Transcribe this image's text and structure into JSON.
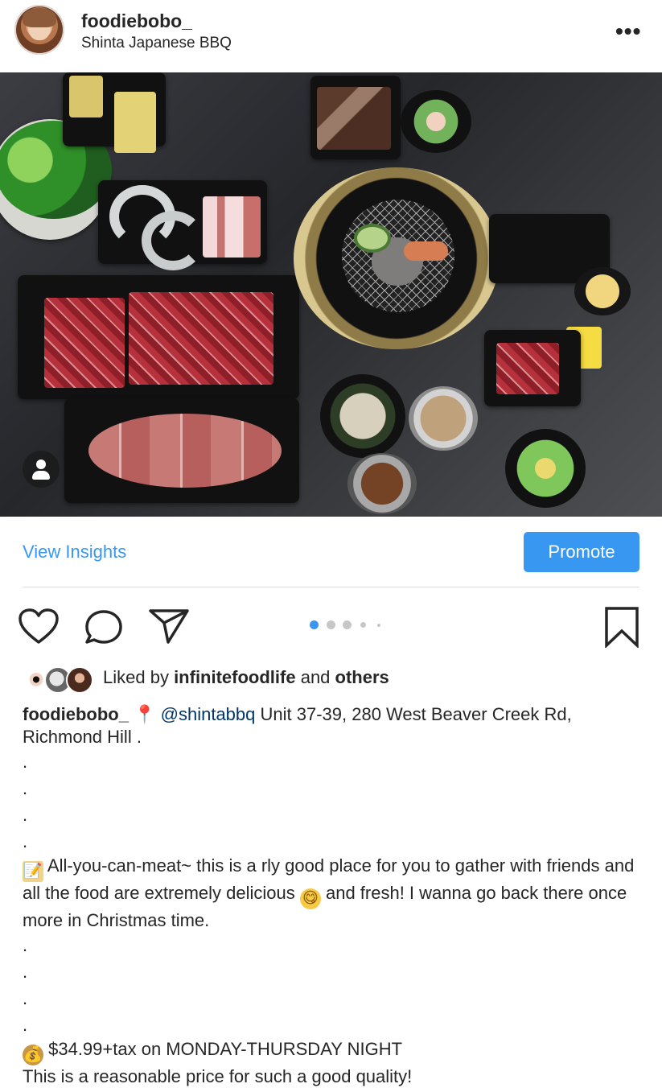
{
  "header": {
    "username": "foodiebobo_",
    "location": "Shinta Japanese BBQ",
    "more_icon": "more-horizontal-icon"
  },
  "media": {
    "image_description_visible": "",
    "user_tag_icon": "person-icon"
  },
  "actions": {
    "view_insights_label": "View Insights",
    "promote_label": "Promote",
    "heart_icon": "heart-icon",
    "comment_icon": "comment-icon",
    "share_icon": "send-icon",
    "bookmark_icon": "bookmark-icon",
    "carousel_dots": 5,
    "active_carousel_index": 0
  },
  "likes": {
    "prefix": "Liked by ",
    "first_user": "infinitefoodlife",
    "middle": " and ",
    "others": "others"
  },
  "caption": {
    "username": "foodiebobo_",
    "pin_emoji": "📍",
    "mention": "@shintabbq",
    "address": " Unit 37-39, 280 West Beaver Creek Rd, Richmond Hill .",
    "dot": ".",
    "pencil_emoji": "📝",
    "description_1": " All-you-can-meat~ this is a rly good place for you to gather with friends and all the food are extremely delicious ",
    "smile_emoji": "😋",
    "description_2": " and fresh! I wanna go back there once more in Christmas time.",
    "money_emoji": "💰",
    "price": " $34.99+tax on MONDAY-THURSDAY NIGHT",
    "price_comment": "This is a reasonable price for such a good quality!"
  },
  "colors": {
    "accent_blue": "#3897f0",
    "text": "#262626",
    "divider": "#dbdbdb",
    "mention": "#003569"
  }
}
